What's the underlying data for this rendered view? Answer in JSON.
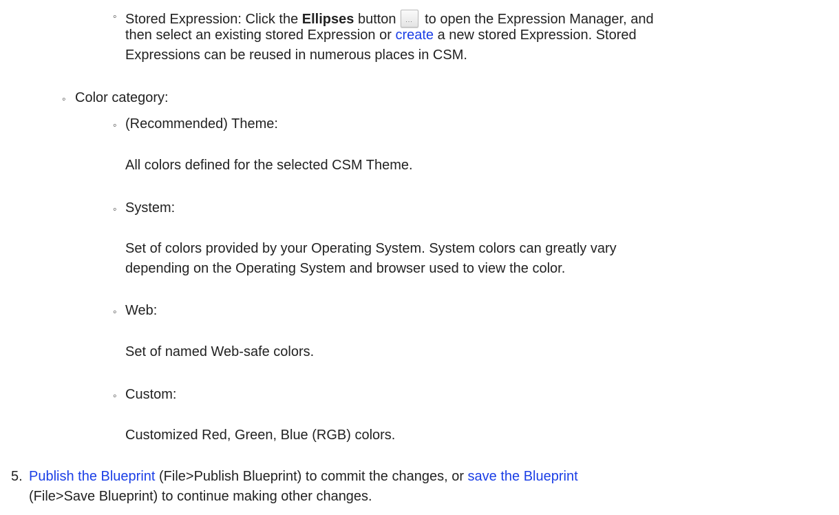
{
  "stored_expression": {
    "line1_prefix": "Stored Expression: Click the ",
    "bold_word": "Ellipses",
    "line1_mid": " button",
    "button_glyph": "...",
    "line1_suffix": " to open the Expression Manager, and",
    "line2_prefix": "then select an existing stored Expression or ",
    "create_link": "create",
    "line2_suffix": " a new stored Expression. Stored",
    "line3": "Expressions can be reused in numerous places in CSM."
  },
  "color_category": {
    "label": "Color category:",
    "items": [
      {
        "label": "(Recommended) Theme:",
        "desc": [
          "All colors defined for the selected CSM Theme."
        ]
      },
      {
        "label": "System:",
        "desc": [
          "Set of colors provided by your Operating System. System colors can greatly vary",
          "depending on the Operating System and browser used to view the color."
        ]
      },
      {
        "label": "Web:",
        "desc": [
          "Set of named Web-safe colors."
        ]
      },
      {
        "label": "Custom:",
        "desc": [
          "Customized Red, Green, Blue (RGB) colors."
        ]
      }
    ]
  },
  "step5": {
    "number": "5.",
    "link1": "Publish the Blueprint",
    "text1": " (File>Publish Blueprint) to commit the changes, or ",
    "link2": "save the Blueprint",
    "line2": "(File>Save Blueprint) to continue making other changes."
  },
  "colors": {
    "link": "#1a3ee6",
    "text": "#222222"
  }
}
